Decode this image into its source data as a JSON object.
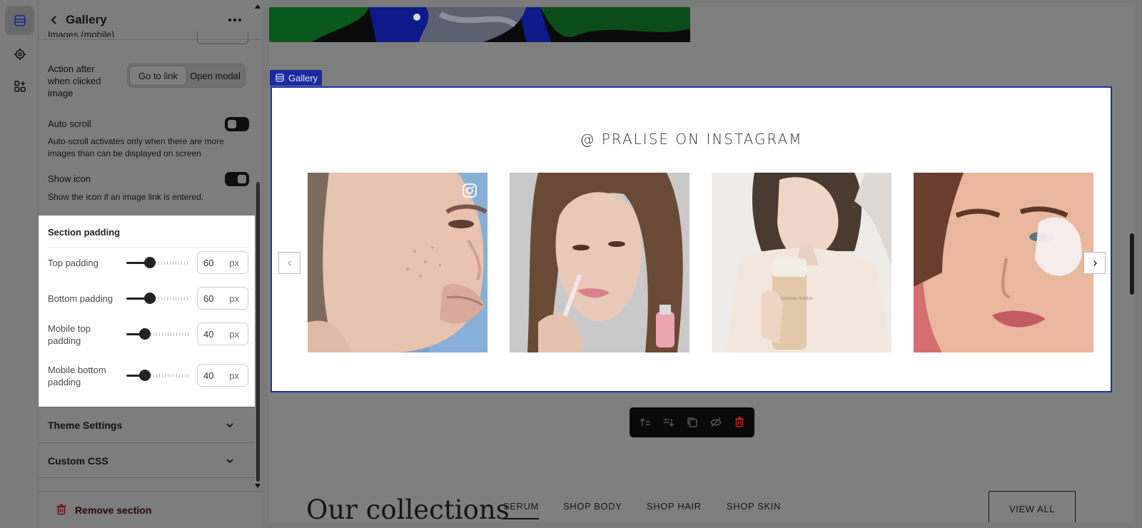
{
  "panel": {
    "title": "Gallery",
    "cut_label": "Images (mobile)",
    "action_label": "Action after when clicked image",
    "action_options": [
      "Go to link",
      "Open modal"
    ],
    "auto_scroll_label": "Auto scroll",
    "auto_scroll_help": "Auto-scroll activates only when there are more images than can be displayed on screen",
    "show_icon_label": "Show icon",
    "show_icon_help": "Show the icon if an image link is entered.",
    "section_padding": {
      "title": "Section padding",
      "rows": [
        {
          "label": "Top padding",
          "value": "60",
          "unit": "px",
          "level": 0.35
        },
        {
          "label": "Bottom padding",
          "value": "60",
          "unit": "px",
          "level": 0.35
        },
        {
          "label": "Mobile top padding",
          "value": "40",
          "unit": "px",
          "level": 0.25
        },
        {
          "label": "Mobile bottom padding",
          "value": "40",
          "unit": "px",
          "level": 0.25
        }
      ]
    },
    "accordions": [
      "Theme Settings",
      "Custom CSS"
    ],
    "remove_label": "Remove section"
  },
  "canvas": {
    "gallery_tag": "Gallery",
    "instagram_title": "@ PRALISE ON INSTAGRAM",
    "collections_title": "Our collections",
    "collection_tabs": [
      "SERUM",
      "SHOP BODY",
      "SHOP HAIR",
      "SHOP SKIN"
    ],
    "view_all": "VIEW ALL",
    "bottle_text": "THE ESSENTIAL WATER"
  },
  "colors": {
    "accent": "#1c2ea8",
    "danger": "#c42020",
    "panel_bg": "#7d7d7d"
  }
}
